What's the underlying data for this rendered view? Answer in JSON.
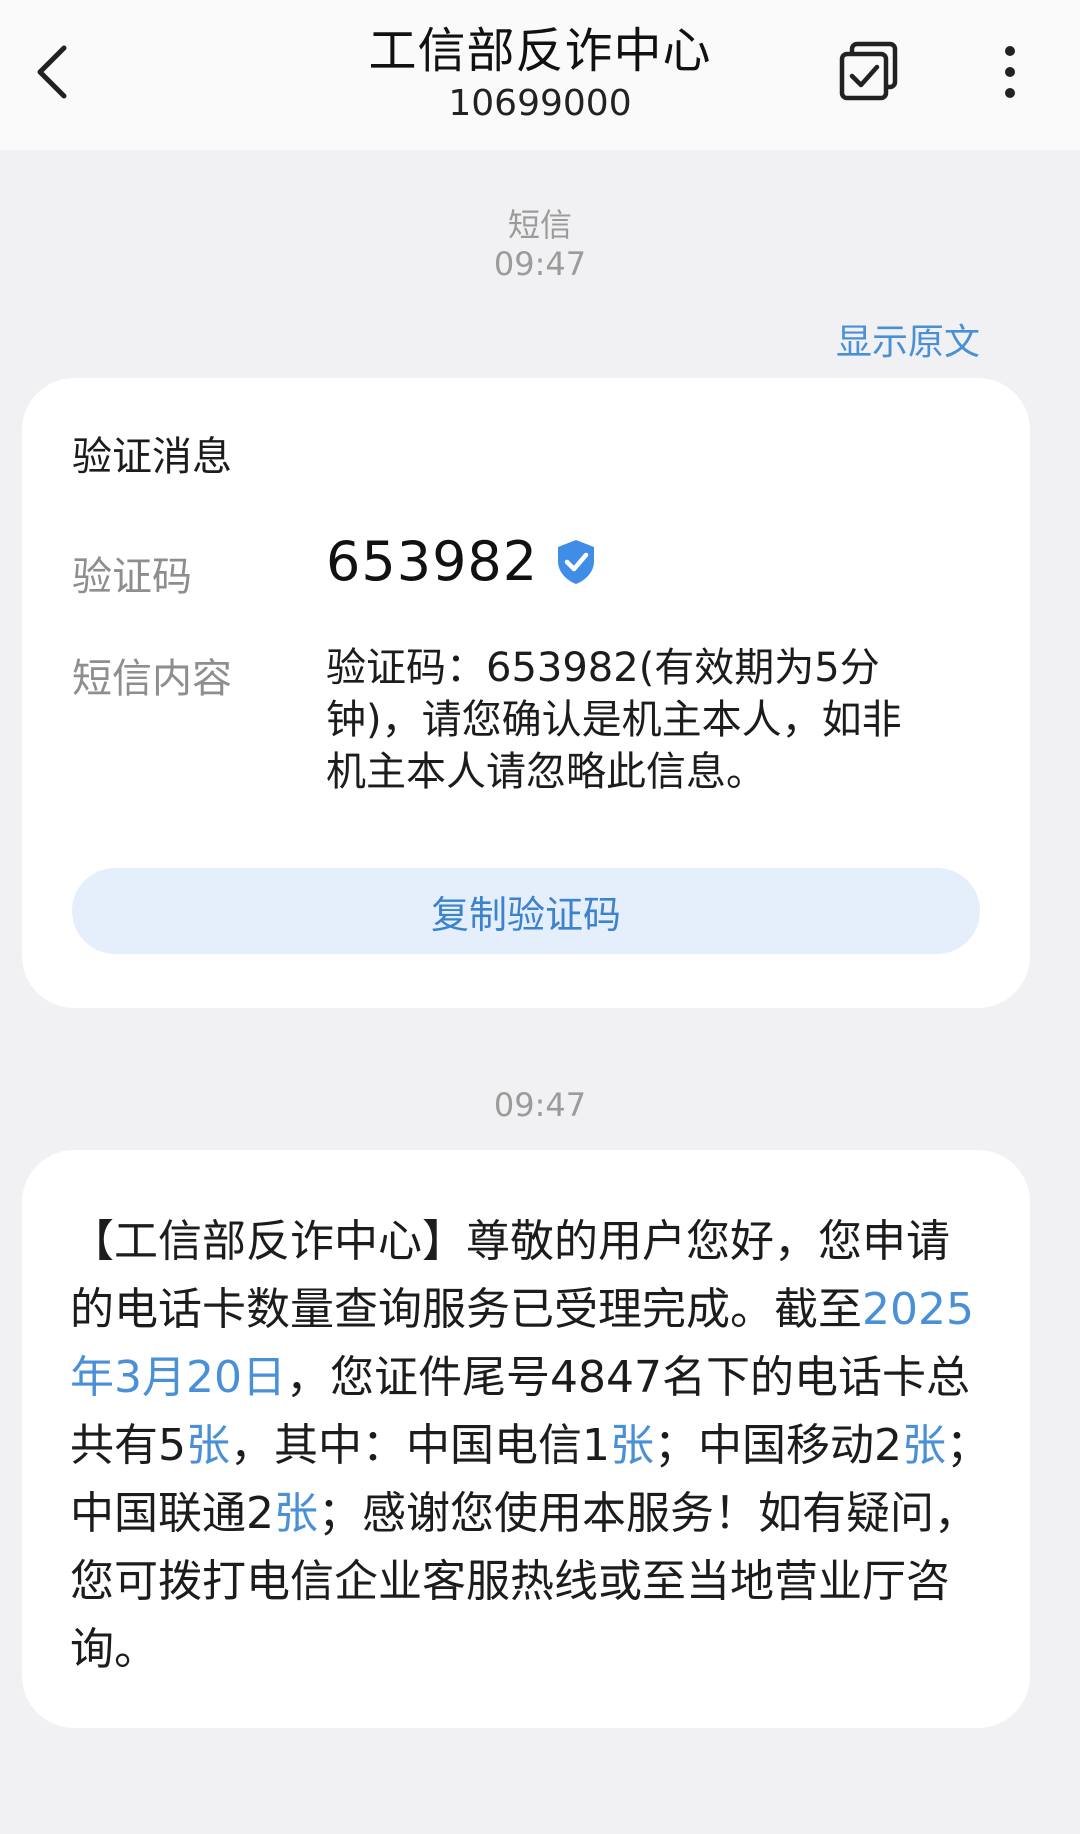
{
  "header": {
    "title": "工信部反诈中心",
    "number": "10699000",
    "icons": {
      "back": "chevron-left-icon",
      "select": "select-checkbox-icon",
      "more": "more-vertical-icon"
    }
  },
  "meta1": {
    "type": "短信",
    "time": "09:47"
  },
  "show_original": "显示原文",
  "verify_card": {
    "heading": "验证消息",
    "code_label": "验证码",
    "code": "653982",
    "content_label": "短信内容",
    "content_line1": "验证码：653982(有效期为5分",
    "content_line2": "钟)，请您确认是机主本人，如非",
    "content_line3": "机主本人请忽略此信息。",
    "copy_button": "复制验证码",
    "badge_icon": "verified-shield-icon"
  },
  "meta2": {
    "time": "09:47"
  },
  "message": {
    "part1": "【工信部反诈中心】尊敬的用户您好，您申请的电话卡数量查询服务已受理完成。截至",
    "date_link": "2025年3月20日",
    "part2": "，您证件尾号4847名下的电话卡总共有5",
    "unit1": "张",
    "part3": "，其中：中国电信1",
    "unit2": "张",
    "part4": "；中国移动2",
    "unit3": "张",
    "part5": "；中国联通2",
    "unit4": "张",
    "part6": "；感谢您使用本服务！如有疑问，您可拨打电信企业客服热线或至当地营业厅咨询。"
  },
  "colors": {
    "accent": "#4a90d6",
    "background": "#f1f1f3",
    "button_bg": "#e5eefb"
  }
}
